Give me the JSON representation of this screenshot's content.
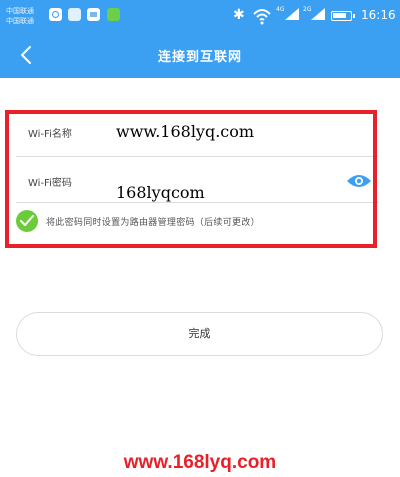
{
  "status_bar": {
    "carrier_1": "中国联通",
    "carrier_2": "中国联通",
    "network_1": "4G",
    "network_2": "2G",
    "time": "16:16",
    "battery_level": 0.85,
    "icons": [
      "app-notification-icon",
      "image-notification-icon",
      "photo-notification-icon",
      "wechat-notification-icon",
      "bluetooth-icon",
      "wifi-signal-icon",
      "cellular-signal-icon",
      "battery-icon"
    ]
  },
  "nav": {
    "title": "连接到互联网",
    "back_icon": "chevron-left-icon"
  },
  "form": {
    "ssid_label": "Wi-Fi名称",
    "ssid_value": "www.168lyq.com",
    "password_label": "Wi-Fi密码",
    "password_value": "168lyqcom",
    "show_password_icon": "eye-icon",
    "sync_admin_password_text": "将此密码同时设置为路由器管理密码（后续可更改）",
    "sync_admin_password_checked": true
  },
  "actions": {
    "done_label": "完成"
  },
  "watermark": {
    "text": "www.168lyq.com"
  },
  "colors": {
    "primary": "#3b9ff2",
    "highlight": "#e8202a",
    "check": "#6ccb3b",
    "background": "#ffffff"
  }
}
